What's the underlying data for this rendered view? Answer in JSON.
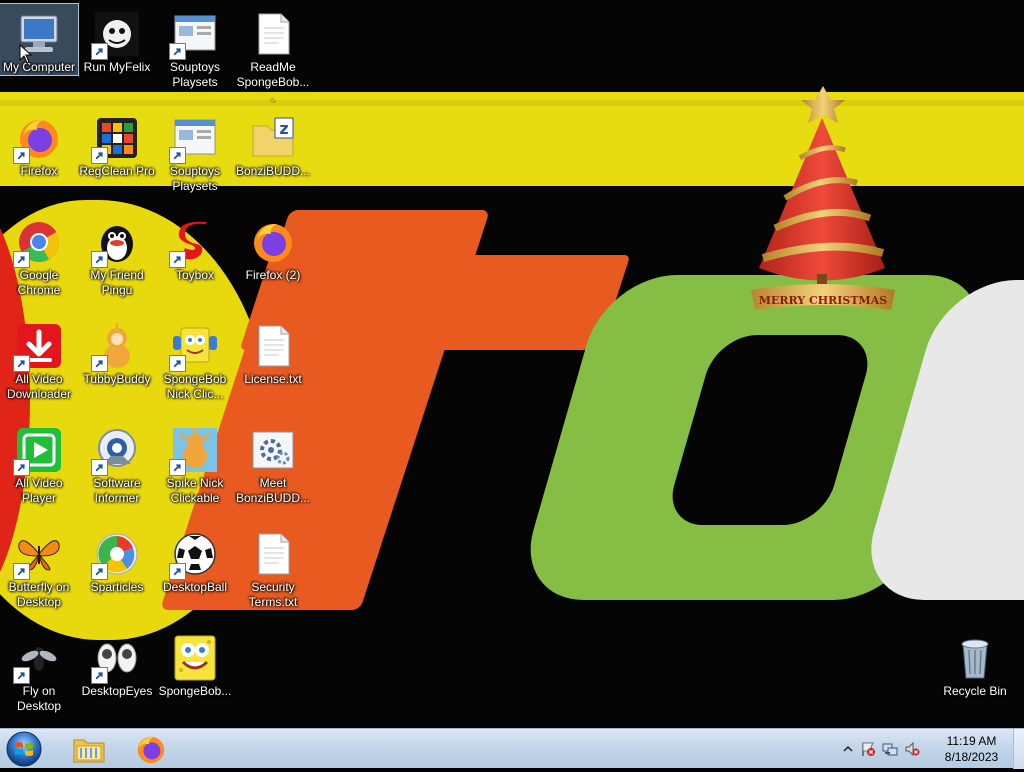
{
  "desktop": {
    "icons": [
      {
        "label": "My Computer",
        "icon": "computer-icon",
        "selected": true
      },
      {
        "label": "Run MyFelix",
        "icon": "myfelix-icon"
      },
      {
        "label": "Souptoys\nPlaysets",
        "icon": "souptoys-icon"
      },
      {
        "label": "ReadMe\nSpongeBob....",
        "icon": "text-file-icon"
      },
      {
        "label": "Firefox",
        "icon": "firefox-icon"
      },
      {
        "label": "RegClean Pro",
        "icon": "regclean-icon"
      },
      {
        "label": "Souptoys\nPlaysets",
        "icon": "souptoys-icon"
      },
      {
        "label": "BonziBUDD...",
        "icon": "zip-folder-icon"
      },
      {
        "label": "Google\nChrome",
        "icon": "chrome-icon"
      },
      {
        "label": "My Friend\nPingu",
        "icon": "pingu-icon"
      },
      {
        "label": "Toybox",
        "icon": "toybox-icon"
      },
      {
        "label": "Firefox (2)",
        "icon": "firefox-icon"
      },
      {
        "label": "All Video\nDownloader",
        "icon": "download-icon"
      },
      {
        "label": "TubbyBuddy",
        "icon": "tubbybuddy-icon"
      },
      {
        "label": "SpongeBob\nNick Clic...",
        "icon": "spongebob-icon"
      },
      {
        "label": "License.txt",
        "icon": "text-file-icon"
      },
      {
        "label": "All Video\nPlayer",
        "icon": "play-icon"
      },
      {
        "label": "Software\nInformer",
        "icon": "software-informer-icon"
      },
      {
        "label": "Spike Nick\nClickable",
        "icon": "spike-icon"
      },
      {
        "label": "Meet\nBonziBUDD...",
        "icon": "settings-file-icon"
      },
      {
        "label": "Butterfly on\nDesktop",
        "icon": "butterfly-icon"
      },
      {
        "label": "Sparticles",
        "icon": "sparticles-icon"
      },
      {
        "label": "DesktopBall",
        "icon": "soccer-ball-icon"
      },
      {
        "label": "Security\nTerms.txt",
        "icon": "text-file-icon"
      },
      {
        "label": "Fly on\nDesktop",
        "icon": "fly-icon"
      },
      {
        "label": "DesktopEyes",
        "icon": "eyes-icon"
      },
      {
        "label": "SpongeBob...",
        "icon": "spongebob-icon"
      },
      {
        "label": "Recycle Bin",
        "icon": "recycle-bin-icon"
      }
    ],
    "wallpaper_text": "MERRY CHRISTMAS"
  },
  "taskbar": {
    "pinned": [
      {
        "name": "Windows Explorer",
        "icon": "folder-icon"
      },
      {
        "name": "Firefox",
        "icon": "firefox-icon"
      }
    ],
    "tray": {
      "icons": [
        "show-hidden-icons-chevron",
        "action-center-flag-icon",
        "network-icon",
        "volume-muted-icon"
      ],
      "time": "11:19 AM",
      "date": "8/18/2023"
    }
  },
  "colors": {
    "taskbar": "#c3d6ea",
    "wallpaper_yellow": "#e6dc10",
    "wallpaper_orange": "#e85a20",
    "wallpaper_green": "#86be45"
  }
}
